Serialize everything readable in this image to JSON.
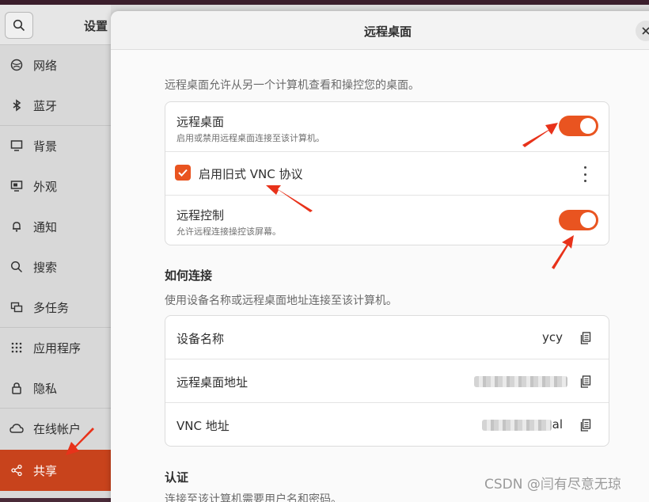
{
  "settings": {
    "title": "设置",
    "sidebar": [
      {
        "label": "网络",
        "icon": "network-icon"
      },
      {
        "label": "蓝牙",
        "icon": "bluetooth-icon"
      },
      {
        "label": "背景",
        "icon": "background-icon"
      },
      {
        "label": "外观",
        "icon": "appearance-icon"
      },
      {
        "label": "通知",
        "icon": "bell-icon"
      },
      {
        "label": "搜索",
        "icon": "search-icon"
      },
      {
        "label": "多任务",
        "icon": "multitask-icon"
      },
      {
        "label": "应用程序",
        "icon": "apps-grid-icon"
      },
      {
        "label": "隐私",
        "icon": "lock-icon"
      },
      {
        "label": "在线帐户",
        "icon": "cloud-icon"
      },
      {
        "label": "共享",
        "icon": "share-icon",
        "active": true
      }
    ]
  },
  "dialog": {
    "title": "远程桌面",
    "intro": "远程桌面允许从另一个计算机查看和操控您的桌面。",
    "remote_desktop": {
      "title": "远程桌面",
      "subtitle": "启用或禁用远程桌面连接至该计算机。",
      "enabled": true
    },
    "legacy_vnc": {
      "label": "启用旧式 VNC 协议",
      "checked": true
    },
    "remote_control": {
      "title": "远程控制",
      "subtitle": "允许远程连接操控该屏幕。",
      "enabled": true
    },
    "how_to_connect": {
      "title": "如何连接",
      "subtitle": "使用设备名称或远程桌面地址连接至该计算机。",
      "rows": [
        {
          "label": "设备名称",
          "value": "ycy"
        },
        {
          "label": "远程桌面地址",
          "value": ""
        },
        {
          "label": "VNC 地址",
          "value": "al"
        }
      ]
    },
    "auth": {
      "title": "认证",
      "subtitle": "连接至该计算机需要用户名和密码。"
    }
  },
  "colors": {
    "accent": "#e95420",
    "active_nav": "#c8431c",
    "arrow": "#e8321a"
  },
  "watermark": "CSDN @闫有尽意无琼"
}
